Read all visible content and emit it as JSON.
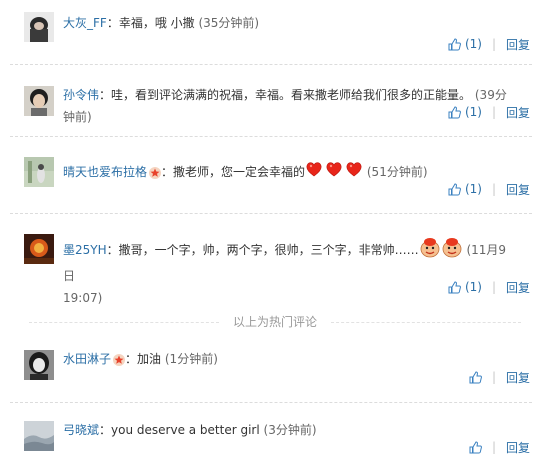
{
  "comments": [
    {
      "user": "大灰_FF",
      "text": "幸福，哦 小撒",
      "time": "(35分钟前)",
      "likes": "(1)",
      "reply": "回复"
    },
    {
      "user": "孙令伟",
      "text": "哇，看到评论满满的祝福，幸福。看来撒老师给我们很多的正能量。",
      "time": "(39分钟前)",
      "likes": "(1)",
      "reply": "回复"
    },
    {
      "user": "晴天也爱布拉格",
      "text": "撒老师，您一定会幸福的",
      "time": "(51分钟前)",
      "likes": "(1)",
      "reply": "回复"
    },
    {
      "user": "墨25YH",
      "text": "撒哥，一个字，帅，两个字，很帅，三个字，非常帅……",
      "time": "(11月9日",
      "time2": "19:07)",
      "likes": "(1)",
      "reply": "回复"
    },
    {
      "user": "水田淋子",
      "text": "加油",
      "time": "(1分钟前)",
      "likes": "",
      "reply": "回复"
    },
    {
      "user": "弓晓斌",
      "text": "you deserve a better girl",
      "time": "(3分钟前)",
      "likes": "",
      "reply": "回复"
    }
  ],
  "hot_label": "以上为热门评论",
  "colors": {
    "link": "#2c6fa6",
    "text": "#333333",
    "muted": "#666666",
    "divider": "#dcdcdc"
  }
}
